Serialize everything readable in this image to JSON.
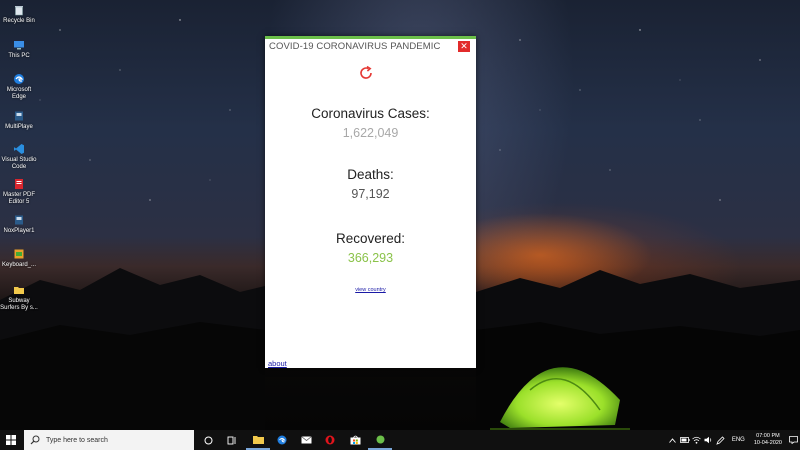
{
  "desktop": {
    "icons": [
      {
        "label": "Recycle Bin"
      },
      {
        "label": "This PC"
      },
      {
        "label": "Microsoft Edge"
      },
      {
        "label": "MultiPlaye"
      },
      {
        "label": "Visual Studio Code"
      },
      {
        "label": "Master PDF Editor 5"
      },
      {
        "label": "NoxPlayer1"
      },
      {
        "label": "Keyboard_..."
      },
      {
        "label": "Subway Surfers By s..."
      }
    ]
  },
  "widget": {
    "title": "COVID-19 CORONAVIRUS PANDEMIC",
    "close_label": "✕",
    "cases_label": "Coronavirus Cases:",
    "cases_value": "1,622,049",
    "deaths_label": "Deaths:",
    "deaths_value": "97,192",
    "recovered_label": "Recovered:",
    "recovered_value": "366,293",
    "view_country_label": "view country",
    "about_label": "about",
    "colors": {
      "accent": "#6cc04a",
      "cases": "#a8a8a8",
      "deaths": "#555555",
      "recovered": "#8bc34a",
      "refresh": "#e53935",
      "close": "#e22b2b"
    }
  },
  "taskbar": {
    "search_placeholder": "Type here to search",
    "language": "ENG",
    "time": "07:00 PM",
    "date": "10-04-2020",
    "pinned": [
      "task-view",
      "file-explorer",
      "microsoft-edge",
      "mail",
      "opera",
      "microsoft-store",
      "widget-app"
    ]
  }
}
